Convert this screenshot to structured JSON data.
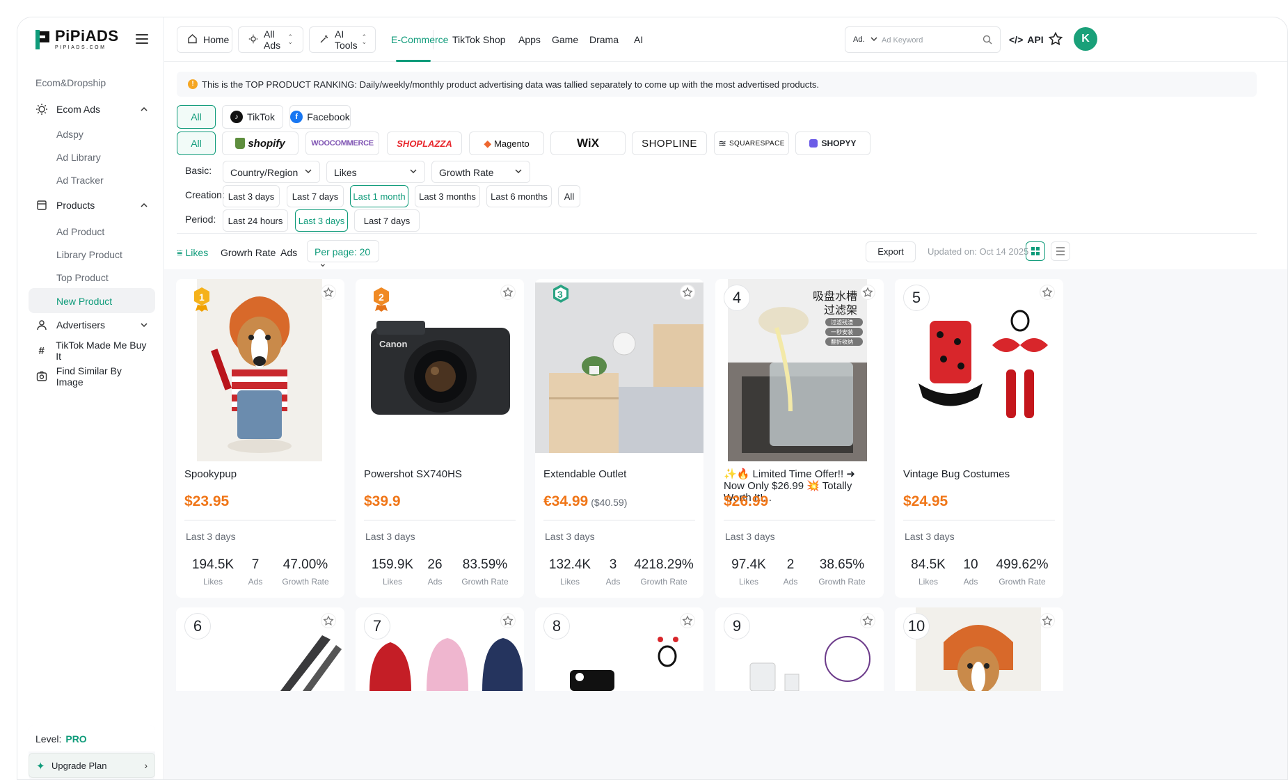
{
  "brand": {
    "name": "PiPiADS",
    "sub": "PIPIADS.COM"
  },
  "sidebar": {
    "section": "Ecom&Dropship",
    "ecom_ads": {
      "label": "Ecom Ads",
      "items": [
        "Adspy",
        "Ad Library",
        "Ad Tracker"
      ]
    },
    "products": {
      "label": "Products",
      "items": [
        "Ad Product",
        "Library Product",
        "Top Product",
        "New Product"
      ],
      "active": "New Product"
    },
    "advertisers": "Advertisers",
    "tiktok": "TikTok Made Me Buy It",
    "find_similar": "Find Similar By Image",
    "level_label": "Level:",
    "level_value": "PRO",
    "upgrade": "Upgrade Plan"
  },
  "topbar": {
    "home": "Home",
    "all_ads": "All Ads",
    "ai_tools": "AI Tools",
    "tabs": [
      "E-Commerce",
      "TikTok Shop",
      "Apps",
      "Game",
      "Drama",
      "AI"
    ],
    "active_tab": "E-Commerce",
    "search_select": "Ad.",
    "search_placeholder": "Ad Keyword",
    "api": "API",
    "avatar": "K"
  },
  "notice": "This is the TOP PRODUCT RANKING: Daily/weekly/monthly product advertising data was tallied separately to come up with the most advertised products.",
  "platforms": [
    "All",
    "TikTok",
    "Facebook"
  ],
  "stores": [
    "All",
    "shopify",
    "WOOCOMMERCE",
    "SHOPLAZZA",
    "Magento",
    "WiX",
    "SHOPLINE",
    "SQUARESPACE",
    "SHOPYY"
  ],
  "filters": {
    "basic_label": "Basic:",
    "basic": [
      "Country/Region",
      "Likes",
      "Growth Rate"
    ],
    "creation_label": "Creation:",
    "creation": [
      "Last 3 days",
      "Last 7 days",
      "Last 1 month",
      "Last 3 months",
      "Last 6 months",
      "All"
    ],
    "creation_selected": "Last 1 month",
    "period_label": "Period:",
    "period": [
      "Last 24 hours",
      "Last 3 days",
      "Last 7 days"
    ],
    "period_selected": "Last 3 days"
  },
  "toolbar": {
    "sort": [
      "Likes",
      "Growrh Rate",
      "Ads"
    ],
    "per_page": "Per page: 20",
    "export": "Export",
    "updated": "Updated on: Oct 14 2025"
  },
  "products": [
    {
      "rank": "1",
      "title": "Spookypup",
      "price": "$23.95",
      "orig": "",
      "period": "Last 3 days",
      "likes": "194.5K",
      "ads": "7",
      "growth": "47.00%"
    },
    {
      "rank": "2",
      "title": "Powershot SX740HS",
      "price": "$39.9",
      "orig": "",
      "period": "Last 3 days",
      "likes": "159.9K",
      "ads": "26",
      "growth": "83.59%"
    },
    {
      "rank": "3",
      "title": "Extendable Outlet",
      "price": "€34.99",
      "orig": "($40.59)",
      "period": "Last 3 days",
      "likes": "132.4K",
      "ads": "3",
      "growth": "4218.29%"
    },
    {
      "rank": "4",
      "title": "✨🔥 Limited Time Offer!! ➜ Now Only $26.99 💥 Totally Worth It!...",
      "price": "$26.99",
      "orig": "",
      "period": "Last 3 days",
      "likes": "97.4K",
      "ads": "2",
      "growth": "38.65%"
    },
    {
      "rank": "5",
      "title": "Vintage Bug Costumes",
      "price": "$24.95",
      "orig": "",
      "period": "Last 3 days",
      "likes": "84.5K",
      "ads": "10",
      "growth": "499.62%"
    }
  ],
  "stat_labels": {
    "likes": "Likes",
    "ads": "Ads",
    "growth": "Growth Rate"
  },
  "next_ranks": [
    "6",
    "7",
    "8",
    "9",
    "10"
  ],
  "image4_text": {
    "line1": "吸盘水槽",
    "line2": "过滤架",
    "tags": [
      "过滤残渣",
      "一秒安装",
      "翻折收纳"
    ]
  },
  "colors": {
    "accent": "#0f9b7a",
    "price": "#f07618",
    "gold": "#f5b21b",
    "silver": "#f08a24",
    "bronze": "#2aa383"
  }
}
